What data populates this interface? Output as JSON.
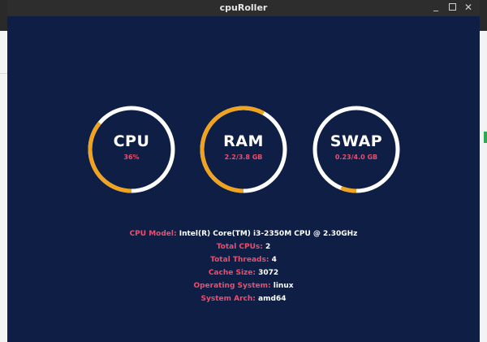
{
  "window": {
    "title": "cpuRoller"
  },
  "colors": {
    "accent": "#e94f6e",
    "arc": "#f0a31f",
    "ring": "#ffffff",
    "background": "#0f1e45"
  },
  "gauges": [
    {
      "label": "CPU",
      "value": "36%",
      "fraction": 0.36
    },
    {
      "label": "RAM",
      "value": "2.2/3.8 GB",
      "fraction": 0.58
    },
    {
      "label": "SWAP",
      "value": "0.23/4.0 GB",
      "fraction": 0.06
    }
  ],
  "info": [
    {
      "key": "CPU Model:",
      "value": "Intel(R) Core(TM) i3-2350M CPU @ 2.30GHz"
    },
    {
      "key": "Total CPUs:",
      "value": "2"
    },
    {
      "key": "Total Threads:",
      "value": "4"
    },
    {
      "key": "Cache Size:",
      "value": "3072"
    },
    {
      "key": "Operating System:",
      "value": "linux"
    },
    {
      "key": "System Arch:",
      "value": "amd64"
    }
  ]
}
